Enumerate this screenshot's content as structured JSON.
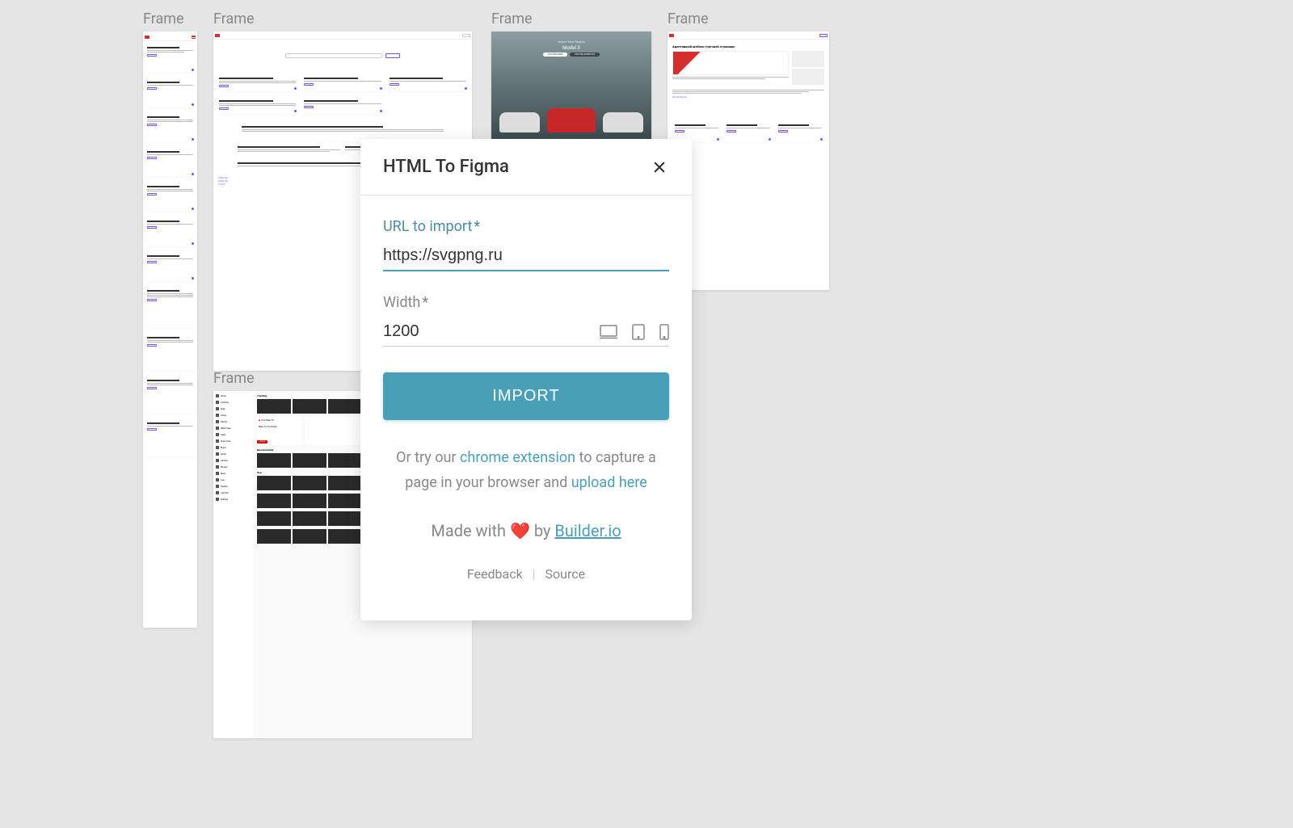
{
  "frames": {
    "frame1": {
      "label": "Frame"
    },
    "frame2": {
      "label": "Frame"
    },
    "frame3": {
      "label": "Frame"
    },
    "frame4": {
      "label": "Frame"
    },
    "frame5": {
      "label": "Frame"
    }
  },
  "tesla": {
    "region": "Select Your Region",
    "model": "Model 3",
    "btn1": "CUSTOM ORDER",
    "btn2": "EXISTING INVENTORY"
  },
  "modal": {
    "title": "HTML To Figma",
    "url_label": "URL to import",
    "url_required": "*",
    "url_value": "https://svgpng.ru",
    "width_label": "Width",
    "width_required": "*",
    "width_value": "1200",
    "import_btn": "IMPORT",
    "helper_prefix": "Or try our ",
    "helper_link1": "chrome extension",
    "helper_mid": " to capture a page in your browser and ",
    "helper_link2": "upload here",
    "credit_prefix": "Made with ",
    "credit_heart": "❤️",
    "credit_by": " by ",
    "credit_link": "Builder.io",
    "footer_feedback": "Feedback",
    "footer_sep": "|",
    "footer_source": "Source"
  }
}
